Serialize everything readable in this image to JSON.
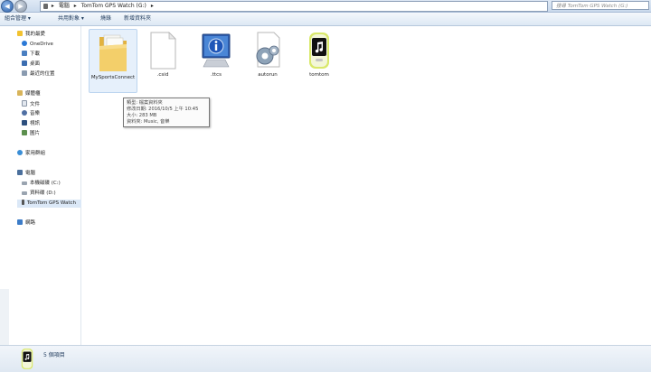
{
  "address": {
    "segments": [
      "電腦",
      "TomTom GPS Watch (G:)"
    ],
    "search_placeholder": "搜尋 TomTom GPS Watch (G:)"
  },
  "toolbar": {
    "organize_label": "組合管理 ▾",
    "share_label": "共用對象 ▾",
    "burn_label": "燒錄",
    "new_folder_label": "新增資料夾"
  },
  "nav": {
    "favorites": {
      "label": "我的最愛",
      "items": [
        "OneDrive",
        "下載",
        "桌面",
        "最近的位置"
      ]
    },
    "libraries": {
      "label": "媒體櫃",
      "items": [
        "文件",
        "音樂",
        "視訊",
        "圖片"
      ]
    },
    "homegroup": {
      "label": "家用群組"
    },
    "computer": {
      "label": "電腦",
      "items": [
        "本機磁碟 (C:)",
        "資料碟 (D:)",
        "TomTom GPS Watch"
      ]
    },
    "network": {
      "label": "網路"
    }
  },
  "files": [
    {
      "name": "MySportsConnect",
      "icon": "folder-icon"
    },
    {
      "name": ".csid",
      "icon": "blank-file-icon"
    },
    {
      "name": ".ttcs",
      "icon": "info-file-icon"
    },
    {
      "name": "autorun",
      "icon": "settings-file-icon"
    },
    {
      "name": "tomtom",
      "icon": "tomtom-watch-icon"
    }
  ],
  "tooltip": {
    "type": "類型: 檔案資料夾",
    "modified": "修改日期: 2016/10/5 上午 10:45",
    "size": "大小: 283 MB",
    "contents": "資料夾: Music, 音樂"
  },
  "status": {
    "text": "5 個項目"
  }
}
